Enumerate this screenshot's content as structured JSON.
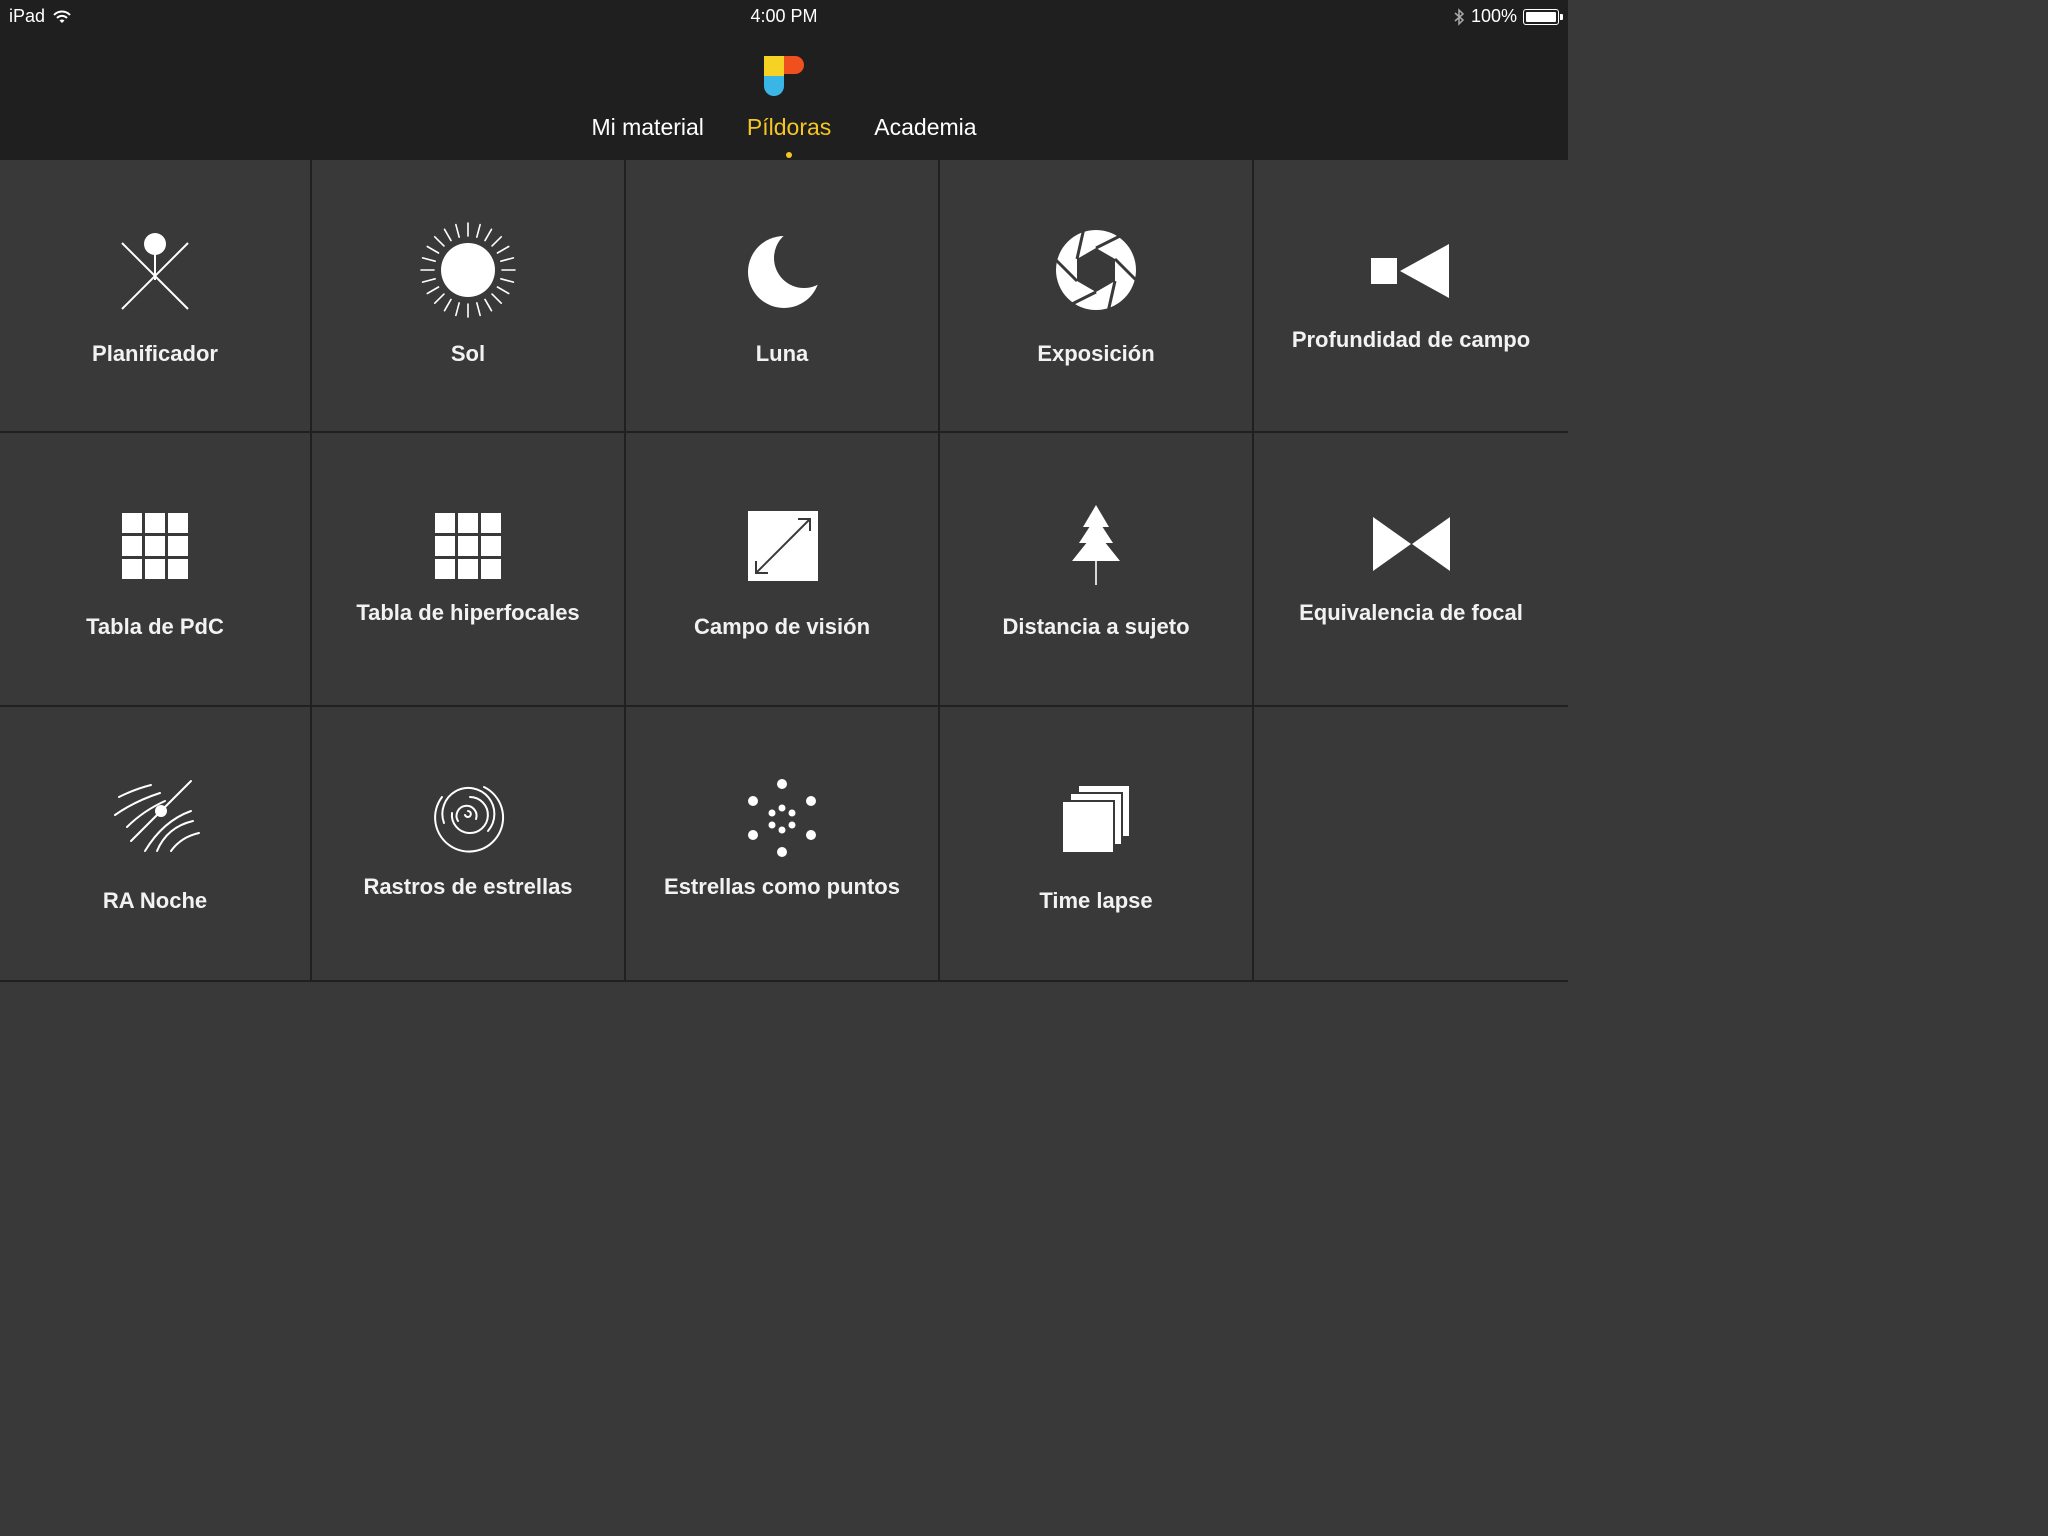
{
  "status_bar": {
    "device": "iPad",
    "time": "4:00 PM",
    "battery_text": "100%",
    "battery_level": 1.0,
    "icons": [
      "wifi-icon",
      "bluetooth-icon",
      "battery-icon"
    ]
  },
  "header": {
    "logo_icon": "app-logo-icon",
    "tabs": [
      {
        "label": "Mi material",
        "active": false
      },
      {
        "label": "Píldoras",
        "active": true
      },
      {
        "label": "Academia",
        "active": false
      }
    ]
  },
  "colors": {
    "accent": "#f5c623",
    "header_bg": "#1f1f1f",
    "grid_bg": "#393939",
    "divider": "#202020",
    "logo_yellow": "#f5d223",
    "logo_orange": "#f0501e",
    "logo_blue": "#3ab6e6"
  },
  "tiles": [
    {
      "label": "Planificador",
      "icon": "planner-icon"
    },
    {
      "label": "Sol",
      "icon": "sun-icon"
    },
    {
      "label": "Luna",
      "icon": "moon-icon"
    },
    {
      "label": "Exposición",
      "icon": "aperture-icon"
    },
    {
      "label": "Profundidad de campo",
      "icon": "depth-of-field-icon"
    },
    {
      "label": "Tabla de PdC",
      "icon": "grid-table-icon"
    },
    {
      "label": "Tabla de hiperfocales",
      "icon": "grid-table-icon"
    },
    {
      "label": "Campo de visión",
      "icon": "field-of-view-icon"
    },
    {
      "label": "Distancia a sujeto",
      "icon": "tree-icon"
    },
    {
      "label": "Equivalencia de focal",
      "icon": "focal-equivalence-icon"
    },
    {
      "label": "RA Noche",
      "icon": "night-ar-icon"
    },
    {
      "label": "Rastros de estrellas",
      "icon": "star-trails-icon"
    },
    {
      "label": "Estrellas como puntos",
      "icon": "star-points-icon"
    },
    {
      "label": "Time lapse",
      "icon": "time-lapse-icon"
    }
  ]
}
